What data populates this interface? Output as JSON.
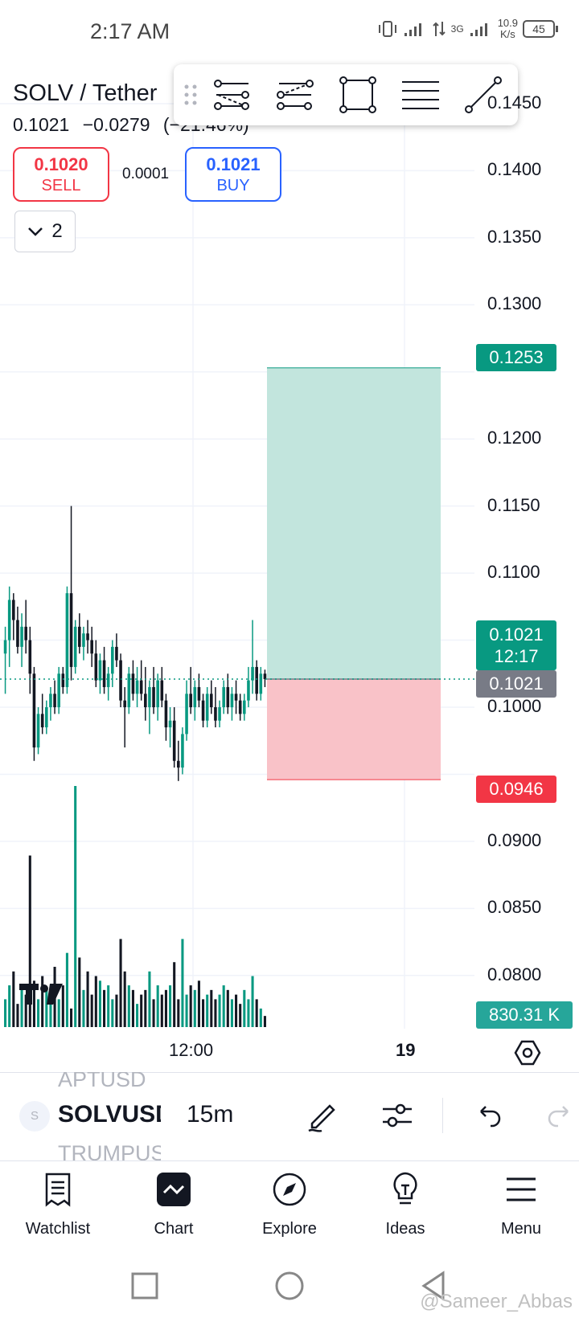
{
  "status_bar": {
    "time": "2:17 AM",
    "network_type": "3G",
    "speed_value": "10.9",
    "speed_unit": "K/s",
    "battery": "45"
  },
  "header": {
    "symbol": "SOLV / Tether",
    "last_price": "0.1021",
    "change": "−0.0279",
    "change_pct": "(−21.46%)"
  },
  "trade": {
    "sell_price": "0.1020",
    "sell_label": "SELL",
    "spread": "0.0001",
    "buy_price": "0.1021",
    "buy_label": "BUY"
  },
  "indicators_toggle": {
    "count": "2"
  },
  "drawing_toolbar": {
    "tools": [
      "parallel-channel-icon",
      "fib-retracement-icon",
      "rectangle-icon",
      "horizontal-lines-icon",
      "trend-line-icon"
    ]
  },
  "price_axis": {
    "labels": [
      "0.1450",
      "0.1400",
      "0.1350",
      "0.1300",
      "0.1200",
      "0.1150",
      "0.1100",
      "0.1000",
      "0.0900",
      "0.0850",
      "0.0800"
    ],
    "take_profit_tag": "0.1253",
    "current_price_tag": "0.1021",
    "countdown_tag": "12:17",
    "last_price_tag": "0.1021",
    "stop_loss_tag": "0.0946",
    "volume_tag": "830.31 K"
  },
  "time_axis": {
    "labels": [
      "12:00",
      "19"
    ]
  },
  "colors": {
    "bull": "#089981",
    "bear": "#131722",
    "sell": "#f23645",
    "buy": "#2962ff",
    "profit_zone": "#c2e5dd",
    "loss_zone": "#f9c2c8"
  },
  "chart_data": {
    "type": "candlestick",
    "interval": "15m",
    "ylim": [
      0.078,
      0.147
    ],
    "position": {
      "entry": 0.1021,
      "take_profit": 0.1253,
      "stop_loss": 0.0946
    },
    "candles": [
      [
        0.104,
        0.106,
        0.101,
        0.105
      ],
      [
        0.105,
        0.109,
        0.103,
        0.108
      ],
      [
        0.108,
        0.1085,
        0.105,
        0.1065
      ],
      [
        0.1065,
        0.1075,
        0.104,
        0.1045
      ],
      [
        0.1045,
        0.107,
        0.103,
        0.106
      ],
      [
        0.106,
        0.108,
        0.104,
        0.105
      ],
      [
        0.105,
        0.106,
        0.101,
        0.1025
      ],
      [
        0.1025,
        0.103,
        0.096,
        0.097
      ],
      [
        0.097,
        0.1,
        0.0965,
        0.0995
      ],
      [
        0.0995,
        0.101,
        0.098,
        0.0985
      ],
      [
        0.0985,
        0.1005,
        0.098,
        0.1
      ],
      [
        0.1,
        0.1015,
        0.099,
        0.101
      ],
      [
        0.101,
        0.102,
        0.0995,
        0.1
      ],
      [
        0.1,
        0.103,
        0.0995,
        0.1025
      ],
      [
        0.1025,
        0.103,
        0.101,
        0.1015
      ],
      [
        0.1015,
        0.109,
        0.101,
        0.1085
      ],
      [
        0.1085,
        0.115,
        0.102,
        0.103
      ],
      [
        0.103,
        0.1065,
        0.1025,
        0.106
      ],
      [
        0.106,
        0.107,
        0.104,
        0.1045
      ],
      [
        0.1045,
        0.106,
        0.1035,
        0.1055
      ],
      [
        0.1055,
        0.1065,
        0.104,
        0.105
      ],
      [
        0.105,
        0.106,
        0.103,
        0.104
      ],
      [
        0.104,
        0.105,
        0.1015,
        0.102
      ],
      [
        0.102,
        0.104,
        0.101,
        0.1035
      ],
      [
        0.1035,
        0.1045,
        0.101,
        0.1015
      ],
      [
        0.1015,
        0.103,
        0.1005,
        0.1025
      ],
      [
        0.1025,
        0.105,
        0.1015,
        0.1045
      ],
      [
        0.1045,
        0.1055,
        0.103,
        0.1035
      ],
      [
        0.1035,
        0.104,
        0.1,
        0.1005
      ],
      [
        0.1005,
        0.1015,
        0.097,
        0.1
      ],
      [
        0.1,
        0.103,
        0.0995,
        0.1025
      ],
      [
        0.1025,
        0.1035,
        0.1005,
        0.101
      ],
      [
        0.101,
        0.103,
        0.1,
        0.102
      ],
      [
        0.102,
        0.1035,
        0.1005,
        0.101
      ],
      [
        0.101,
        0.103,
        0.099,
        0.1
      ],
      [
        0.1,
        0.102,
        0.098,
        0.1015
      ],
      [
        0.1015,
        0.103,
        0.0995,
        0.1
      ],
      [
        0.1,
        0.1025,
        0.099,
        0.102
      ],
      [
        0.102,
        0.103,
        0.1,
        0.1005
      ],
      [
        0.1005,
        0.101,
        0.0975,
        0.0985
      ],
      [
        0.0985,
        0.1,
        0.097,
        0.099
      ],
      [
        0.099,
        0.1,
        0.0955,
        0.096
      ],
      [
        0.096,
        0.0975,
        0.0945,
        0.0955
      ],
      [
        0.0955,
        0.0985,
        0.095,
        0.098
      ],
      [
        0.098,
        0.102,
        0.0975,
        0.101
      ],
      [
        0.101,
        0.103,
        0.0995,
        0.1
      ],
      [
        0.1,
        0.102,
        0.099,
        0.1015
      ],
      [
        0.1015,
        0.1025,
        0.1,
        0.1005
      ],
      [
        0.1005,
        0.101,
        0.0985,
        0.099
      ],
      [
        0.099,
        0.1015,
        0.0985,
        0.101
      ],
      [
        0.101,
        0.102,
        0.0995,
        0.1
      ],
      [
        0.1,
        0.1015,
        0.0985,
        0.099
      ],
      [
        0.099,
        0.1005,
        0.0985,
        0.1
      ],
      [
        0.1,
        0.102,
        0.0995,
        0.1015
      ],
      [
        0.1015,
        0.1025,
        0.0995,
        0.1
      ],
      [
        0.1,
        0.1015,
        0.099,
        0.101
      ],
      [
        0.101,
        0.102,
        0.0995,
        0.1005
      ],
      [
        0.1005,
        0.101,
        0.099,
        0.0995
      ],
      [
        0.0995,
        0.101,
        0.099,
        0.1005
      ],
      [
        0.1005,
        0.103,
        0.1,
        0.102
      ],
      [
        0.102,
        0.1065,
        0.101,
        0.103
      ],
      [
        0.103,
        0.1035,
        0.1005,
        0.101
      ],
      [
        0.101,
        0.103,
        0.1005,
        0.1025
      ],
      [
        0.1025,
        0.1028,
        0.1015,
        0.1021
      ]
    ],
    "volumes": [
      30,
      45,
      60,
      25,
      40,
      35,
      185,
      50,
      30,
      55,
      40,
      35,
      65,
      30,
      45,
      80,
      20,
      260,
      75,
      40,
      60,
      35,
      55,
      50,
      40,
      45,
      30,
      35,
      95,
      60,
      45,
      40,
      25,
      35,
      40,
      60,
      30,
      45,
      35,
      40,
      45,
      70,
      30,
      95,
      35,
      45,
      40,
      50,
      30,
      35,
      40,
      30,
      35,
      45,
      40,
      30,
      35,
      25,
      40,
      30,
      55,
      30,
      20,
      12
    ]
  },
  "symbol_bar": {
    "prev_symbol": "APTUSD",
    "avatar_letter": "S",
    "current_symbol": "SOLVUSDT",
    "next_symbol": "TRUMPUSDT",
    "interval": "15m"
  },
  "bottom_nav": {
    "items": [
      {
        "label": "Watchlist",
        "icon": "watchlist-icon"
      },
      {
        "label": "Chart",
        "icon": "chart-icon"
      },
      {
        "label": "Explore",
        "icon": "compass-icon"
      },
      {
        "label": "Ideas",
        "icon": "lightbulb-icon"
      },
      {
        "label": "Menu",
        "icon": "hamburger-icon"
      }
    ]
  },
  "watermark": "@Sameer_Abbas"
}
